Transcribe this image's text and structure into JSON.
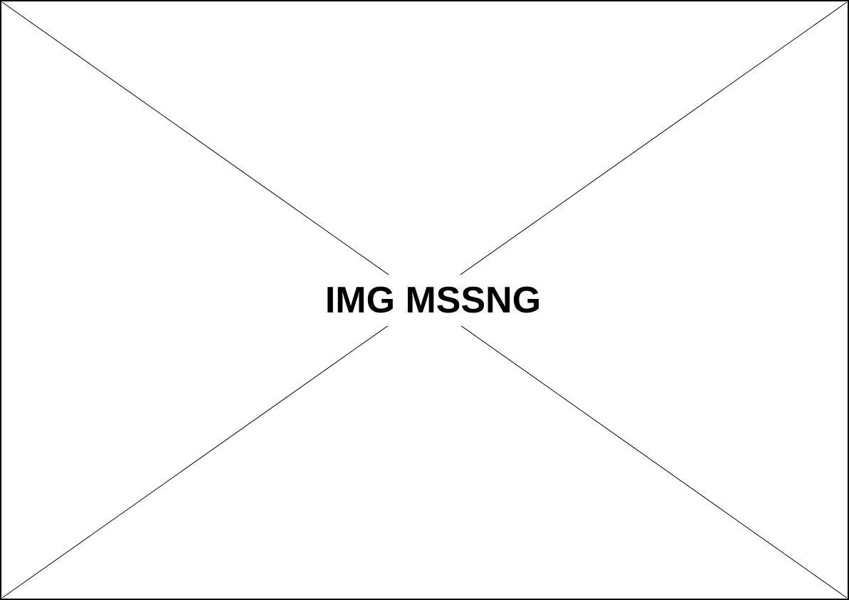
{
  "placeholder": {
    "label": "IMG MSSNG",
    "border_color": "#000000",
    "background_color": "#ffffff",
    "line_color": "#000000"
  }
}
